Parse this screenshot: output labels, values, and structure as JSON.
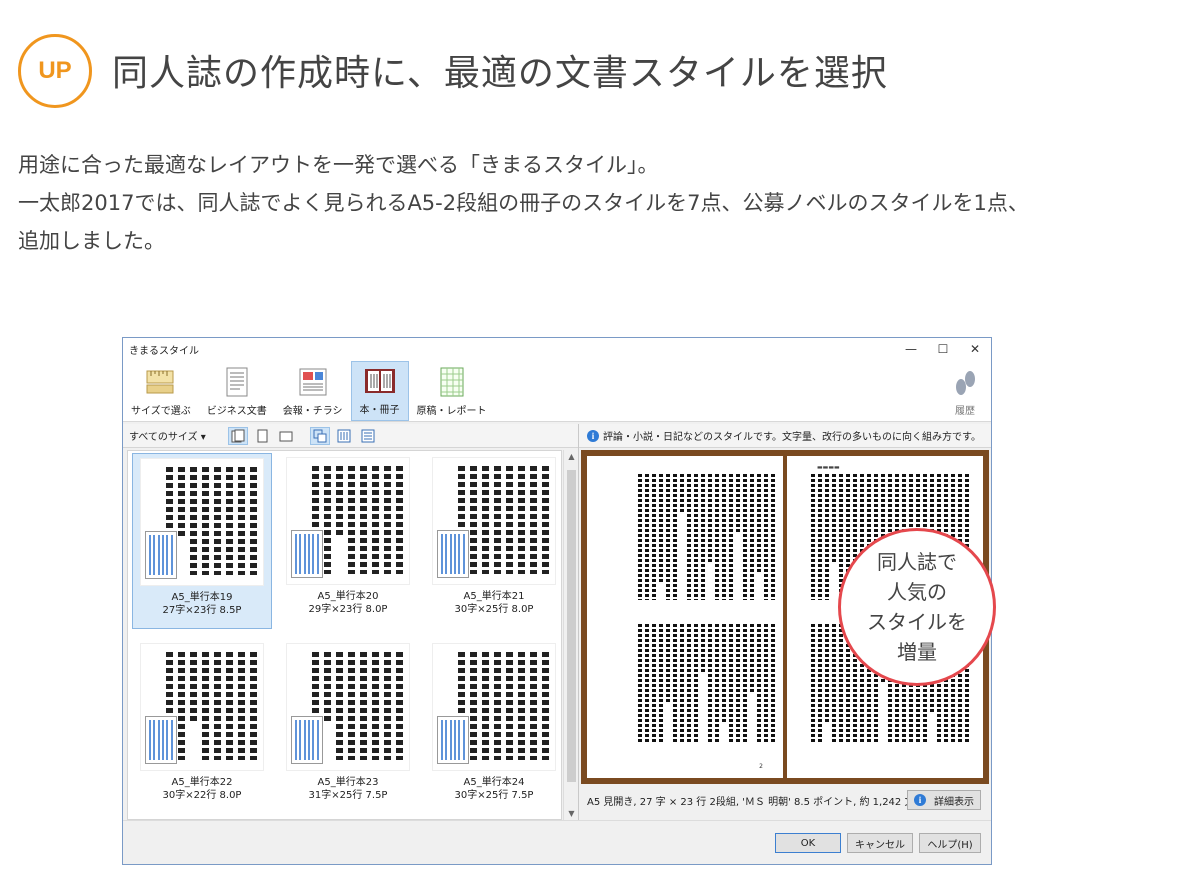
{
  "header": {
    "badge": "UP",
    "title": "同人誌の作成時に、最適の文書スタイルを選択",
    "description_lines": [
      "用途に合った最適なレイアウトを一発で選べる「きまるスタイル」。",
      "一太郎2017では、同人誌でよく見られるA5-2段組の冊子のスタイルを7点、公募ノベルのスタイルを1点、",
      "追加しました。"
    ]
  },
  "dialog": {
    "title": "きまるスタイル",
    "window_controls": {
      "minimize": "—",
      "maximize": "☐",
      "close": "✕"
    },
    "ribbon": [
      {
        "label": "サイズで選ぶ",
        "icon": "ruler-icon",
        "selected": false
      },
      {
        "label": "ビジネス文書",
        "icon": "document-icon",
        "selected": false
      },
      {
        "label": "会報・チラシ",
        "icon": "newsletter-icon",
        "selected": false
      },
      {
        "label": "本・冊子",
        "icon": "book-icon",
        "selected": true
      },
      {
        "label": "原稿・レポート",
        "icon": "manuscript-icon",
        "selected": false
      }
    ],
    "history_label": "履歴",
    "size_filter": "すべてのサイズ",
    "hint": "評論・小説・日記などのスタイルです。文字量、改行の多いものに向く組み方です。",
    "thumbnails": [
      {
        "name": "A5_単行本19",
        "spec": "27字×23行  8.5P",
        "selected": true
      },
      {
        "name": "A5_単行本20",
        "spec": "29字×23行  8.0P",
        "selected": false
      },
      {
        "name": "A5_単行本21",
        "spec": "30字×25行  8.0P",
        "selected": false
      },
      {
        "name": "A5_単行本22",
        "spec": "30字×22行  8.0P",
        "selected": false
      },
      {
        "name": "A5_単行本23",
        "spec": "31字×25行  7.5P",
        "selected": false
      },
      {
        "name": "A5_単行本24",
        "spec": "30字×25行  7.5P",
        "selected": false
      }
    ],
    "status_text": "A5 見開き,  27 字 × 23 行 2段組,  'ＭＳ 明朝' 8.5 ポイント,  約 1,242 文字",
    "detail_button": "詳細表示",
    "buttons": {
      "ok": "OK",
      "cancel": "キャンセル",
      "help": "ヘルプ(H)"
    }
  },
  "callout": {
    "lines": [
      "同人誌で",
      "人気の",
      "スタイルを",
      "増量"
    ],
    "border_color": "#e5484d"
  },
  "colors": {
    "accent": "#f0961e",
    "selection": "#cde3f7",
    "info": "#2f7bd6"
  }
}
